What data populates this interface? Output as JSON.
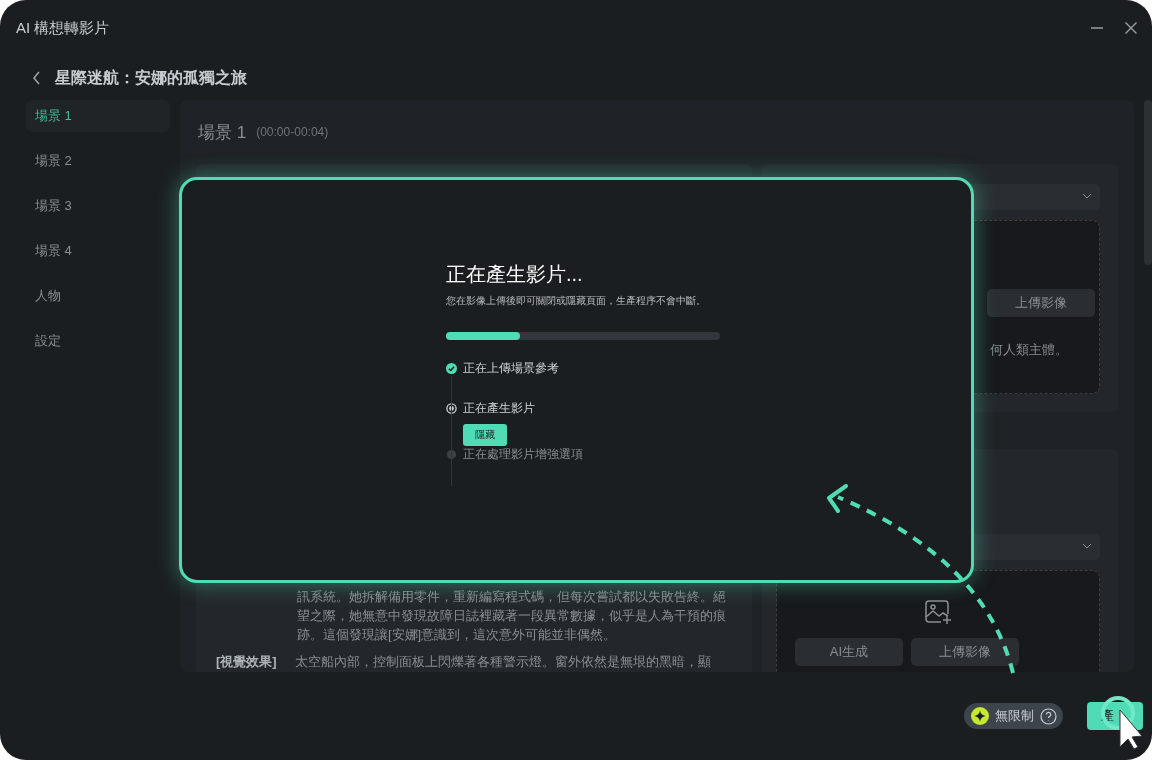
{
  "window": {
    "title": "AI 構想轉影片"
  },
  "header": {
    "title": "星際迷航：安娜的孤獨之旅"
  },
  "sidebar": {
    "items": [
      {
        "label": "場景 1",
        "selected": true
      },
      {
        "label": "場景 2",
        "selected": false
      },
      {
        "label": "場景 3",
        "selected": false
      },
      {
        "label": "場景 4",
        "selected": false
      },
      {
        "label": "人物",
        "selected": false
      },
      {
        "label": "設定",
        "selected": false
      }
    ]
  },
  "scene": {
    "title": "場景 1",
    "time": "(00:00-00:04)",
    "reference_upload": {
      "button": "上傳影像",
      "note": "何人類主體。"
    },
    "story_text": "訊系統。她拆解備用零件，重新編寫程式碼，但每次嘗試都以失敗告終。絕望之際，她無意中發現故障日誌裡藏著一段異常數據，似乎是人為干預的痕跡。這個發現讓[安娜]意識到，這次意外可能並非偶然。",
    "visual_effect": {
      "label": "[視覺效果]",
      "text": "太空船內部，控制面板上閃爍著各種警示燈。窗外依然是無垠的黑暗，顯"
    },
    "image_upload": {
      "buttons": [
        "AI生成",
        "上傳影像"
      ]
    }
  },
  "progress_dialog": {
    "title": "正在產生影片...",
    "subtitle": "您在影像上傳後即可關閉或隱藏頁面，生產程序不會中斷。",
    "level": 0.27,
    "steps": [
      {
        "label": "正在上傳場景參考",
        "kind": "done"
      },
      {
        "label": "正在產生影片",
        "kind": "active",
        "action": "隱藏"
      },
      {
        "label": "正在處理影片增強選項",
        "kind": "pending"
      }
    ]
  },
  "footer": {
    "plan": "無限制",
    "generate_button": "產"
  }
}
